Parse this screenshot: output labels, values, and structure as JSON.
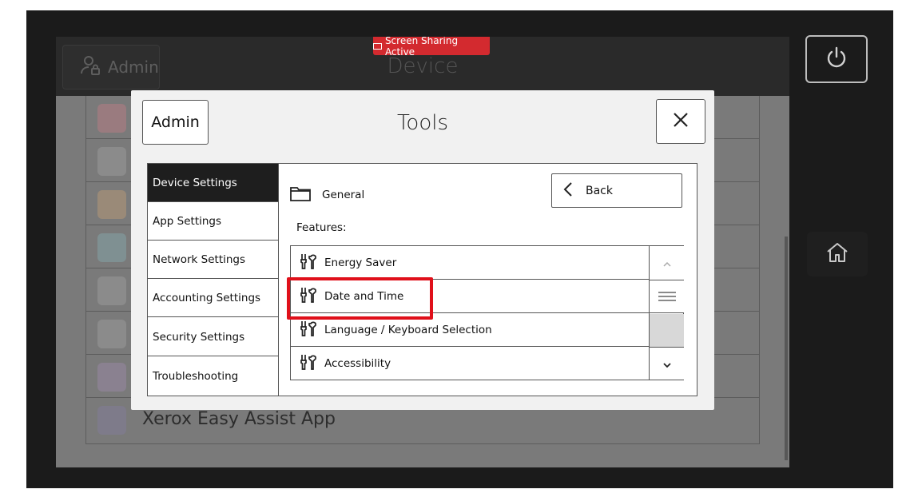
{
  "header": {
    "admin_label": "Admin",
    "title": "Device",
    "sharing_badge": "Screen Sharing Active"
  },
  "background_apps": {
    "visible_label": "Xerox Easy Assist App"
  },
  "dialog": {
    "admin_button": "Admin",
    "title": "Tools",
    "nav": [
      {
        "label": "Device Settings",
        "active": true
      },
      {
        "label": "App Settings",
        "active": false
      },
      {
        "label": "Network Settings",
        "active": false
      },
      {
        "label": "Accounting Settings",
        "active": false
      },
      {
        "label": "Security Settings",
        "active": false
      },
      {
        "label": "Troubleshooting",
        "active": false
      }
    ],
    "breadcrumb": "General",
    "back_label": "Back",
    "features_label": "Features:",
    "features": [
      {
        "label": "Energy Saver",
        "icon": "tools-icon"
      },
      {
        "label": "Date and Time",
        "icon": "tools-icon"
      },
      {
        "label": "Language / Keyboard Selection",
        "icon": "tools-icon"
      },
      {
        "label": "Accessibility",
        "icon": "tools-icon"
      }
    ]
  },
  "colors": {
    "sharing_badge": "#d32a2f",
    "highlight": "#e0101a",
    "active_nav": "#1e1e1e"
  }
}
